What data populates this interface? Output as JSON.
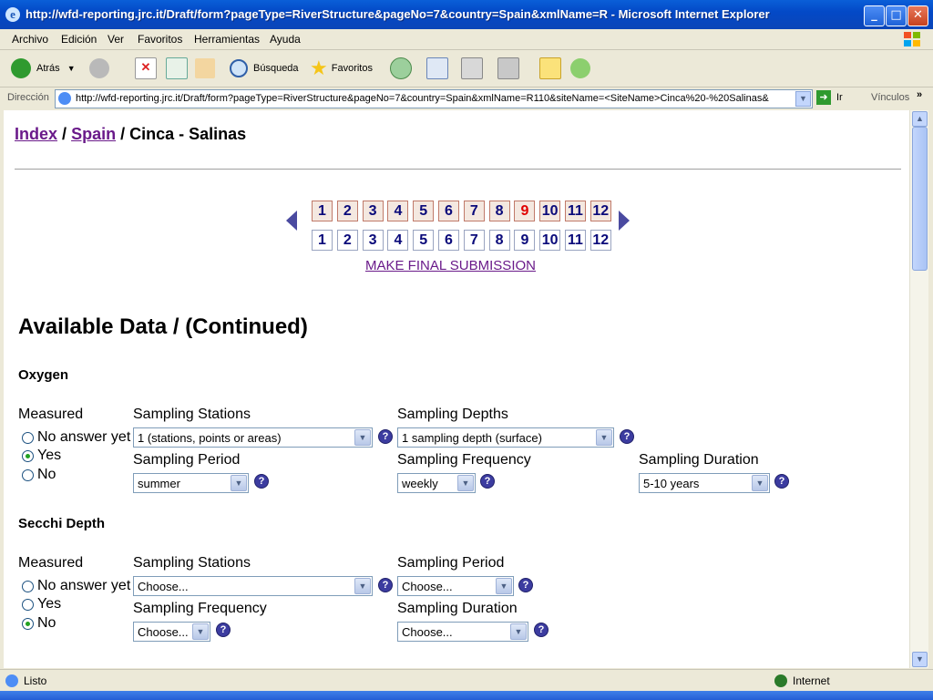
{
  "window": {
    "title": "http://wfd-reporting.jrc.it/Draft/form?pageType=RiverStructure&pageNo=7&country=Spain&xmlName=R - Microsoft Internet Explorer"
  },
  "menu": [
    "Archivo",
    "Edición",
    "Ver",
    "Favoritos",
    "Herramientas",
    "Ayuda"
  ],
  "toolbar": {
    "back": "Atrás",
    "search": "Búsqueda",
    "favorites": "Favoritos"
  },
  "address": {
    "label": "Dirección",
    "url": "http://wfd-reporting.jrc.it/Draft/form?pageType=RiverStructure&pageNo=7&country=Spain&xmlName=R110&siteName=<SiteName>Cinca%20-%20Salinas&",
    "go": "Ir",
    "links": "Vínculos"
  },
  "breadcrumb": {
    "index": "Index",
    "sep1": "/",
    "country": "Spain",
    "sep2": "/",
    "site": "Cinca - Salinas"
  },
  "pager": {
    "top": [
      "1",
      "2",
      "3",
      "4",
      "5",
      "6",
      "7",
      "8",
      "9",
      "10",
      "11",
      "12"
    ],
    "bottom": [
      "1",
      "2",
      "3",
      "4",
      "5",
      "6",
      "7",
      "8",
      "9",
      "10",
      "11",
      "12"
    ],
    "active": "9",
    "final": "MAKE FINAL SUBMISSION"
  },
  "section_title": "Available Data / (Continued)",
  "oxygen": {
    "title": "Oxygen",
    "measured_label": "Measured",
    "options": [
      "No answer yet",
      "Yes",
      "No"
    ],
    "selected": "Yes",
    "stations_label": "Sampling Stations",
    "stations_value": "1 (stations, points or areas)",
    "depths_label": "Sampling Depths",
    "depths_value": "1 sampling depth (surface)",
    "period_label": "Sampling Period",
    "period_value": "summer",
    "frequency_label": "Sampling Frequency",
    "frequency_value": "weekly",
    "duration_label": "Sampling Duration",
    "duration_value": "5-10 years"
  },
  "secchi": {
    "title": "Secchi Depth",
    "measured_label": "Measured",
    "options": [
      "No answer yet",
      "Yes",
      "No"
    ],
    "selected": "No",
    "stations_label": "Sampling Stations",
    "stations_value": "Choose...",
    "period_label": "Sampling Period",
    "period_value": "Choose...",
    "frequency_label": "Sampling Frequency",
    "frequency_value": "Choose...",
    "duration_label": "Sampling Duration",
    "duration_value": "Choose..."
  },
  "help_glyph": "?",
  "status": {
    "left": "Listo",
    "zone": "Internet"
  }
}
